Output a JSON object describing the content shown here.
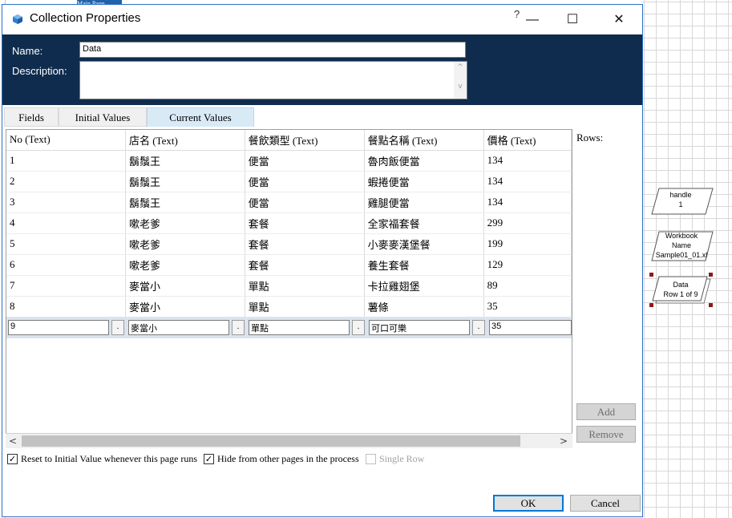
{
  "background": {
    "tab_label": "Main Page",
    "flow_shapes": [
      {
        "line1": "handle",
        "line2": "1",
        "line3": ""
      },
      {
        "line1": "Workbook",
        "line2": "Name",
        "line3": "Sample01_01.xl"
      },
      {
        "line1": "Data",
        "line2": "Row 1 of 9",
        "line3": ""
      }
    ]
  },
  "dialog": {
    "title": "Collection Properties",
    "help_mark": "?",
    "controls": {
      "minimize": "—",
      "maximize": "☐",
      "close": "✕"
    },
    "name_label": "Name:",
    "name_value": "Data",
    "description_label": "Description:",
    "description_value": "",
    "tabs": [
      {
        "label": "Fields",
        "active": false
      },
      {
        "label": "Initial Values",
        "active": false
      },
      {
        "label": "Current Values",
        "active": true
      }
    ],
    "grid": {
      "headers": [
        "No (Text)",
        "店名 (Text)",
        "餐飲類型 (Text)",
        "餐點名稱 (Text)",
        "價格 (Text)"
      ],
      "rows": [
        [
          "1",
          "鬍鬚王",
          "便當",
          "魯肉飯便當",
          "134"
        ],
        [
          "2",
          "鬍鬚王",
          "便當",
          "蝦捲便當",
          "134"
        ],
        [
          "3",
          "鬍鬚王",
          "便當",
          "雞腿便當",
          "134"
        ],
        [
          "4",
          "嗽老爹",
          "套餐",
          "全家福套餐",
          "299"
        ],
        [
          "5",
          "嗽老爹",
          "套餐",
          "小麥麥漢堡餐",
          "199"
        ],
        [
          "6",
          "嗽老爹",
          "套餐",
          "養生套餐",
          "129"
        ],
        [
          "7",
          "麥當小",
          "單點",
          "卡拉雞翅堡",
          "89"
        ],
        [
          "8",
          "麥當小",
          "單點",
          "薯條",
          "35"
        ]
      ],
      "edit_row": [
        "9",
        "麥當小",
        "單點",
        "可口可樂",
        "35"
      ],
      "edit_button_label": "."
    },
    "rows_label": "Rows:",
    "add_label": "Add",
    "remove_label": "Remove",
    "options": [
      {
        "label": "Reset to Initial Value whenever this page runs",
        "checked": true,
        "enabled": true
      },
      {
        "label": "Hide from other pages in the process",
        "checked": true,
        "enabled": true
      },
      {
        "label": "Single Row",
        "checked": false,
        "enabled": false
      }
    ],
    "check_mark": "✓",
    "ok_label": "OK",
    "cancel_label": "Cancel",
    "scroll_left": "<",
    "scroll_right": ">",
    "scroll_up": "^",
    "scroll_down": "v"
  },
  "colors": {
    "header_band": "#0f2c4e",
    "accent": "#0078d7",
    "active_tab": "#d9eaf7",
    "edit_row": "#dce3ee",
    "handle": "#8b1a1a"
  }
}
